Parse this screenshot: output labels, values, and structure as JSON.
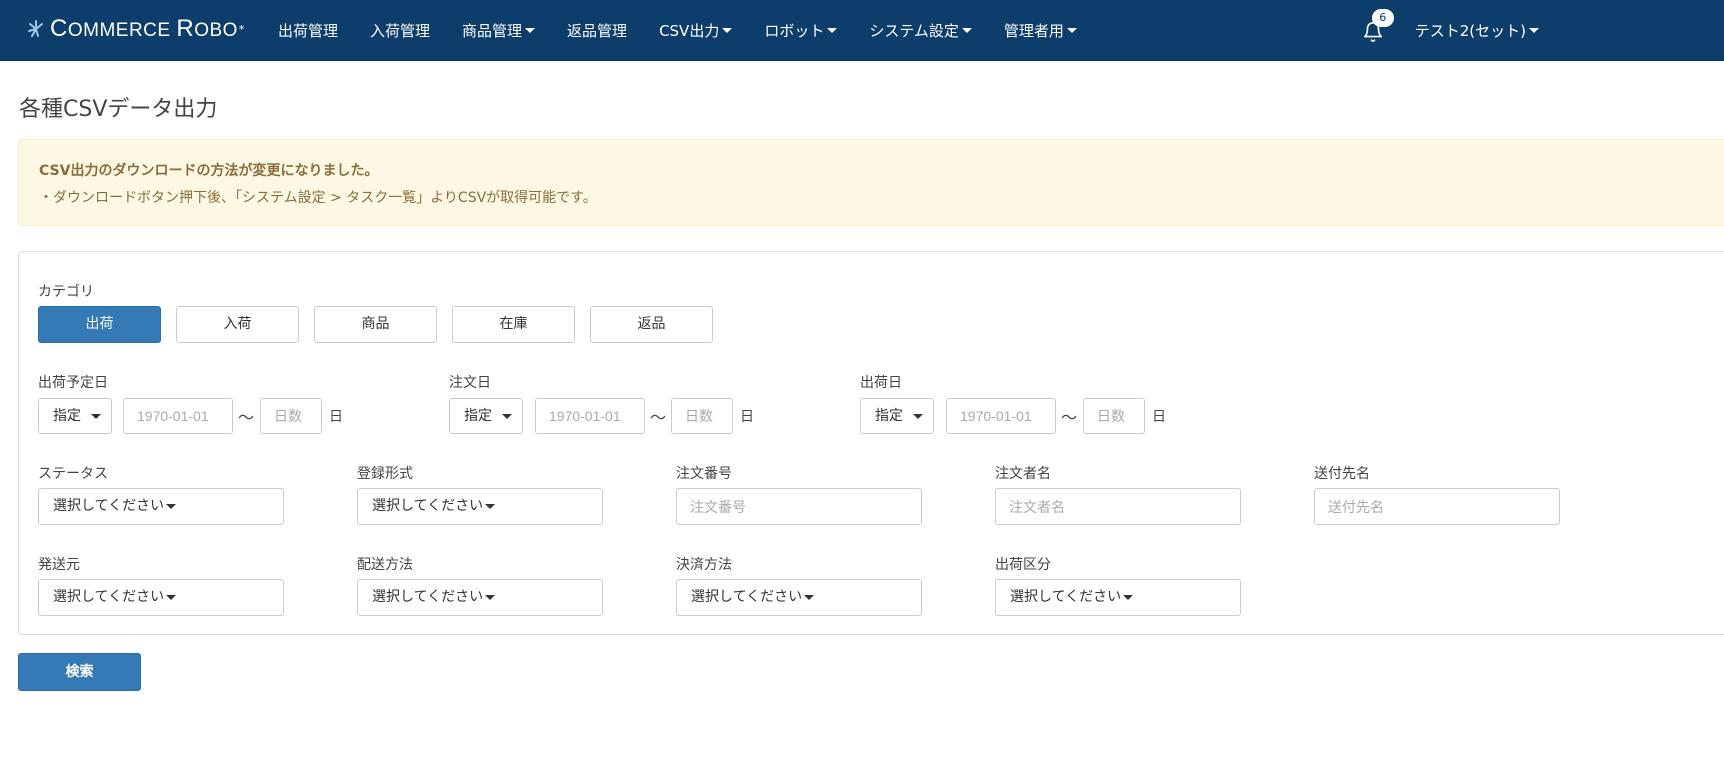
{
  "brand": {
    "name_c": "C",
    "name_ommerce": "OMMERCE ",
    "name_r": "R",
    "name_obo": "OBO",
    "mark": "*"
  },
  "nav": {
    "items": [
      {
        "label": "出荷管理",
        "dropdown": false
      },
      {
        "label": "入荷管理",
        "dropdown": false
      },
      {
        "label": "商品管理",
        "dropdown": true
      },
      {
        "label": "返品管理",
        "dropdown": false
      },
      {
        "label": "CSV出力",
        "dropdown": true
      },
      {
        "label": "ロボット",
        "dropdown": true
      },
      {
        "label": "システム設定",
        "dropdown": true
      },
      {
        "label": "管理者用",
        "dropdown": true
      }
    ],
    "notification_count": "6",
    "user": "テスト2(セット)"
  },
  "page": {
    "title": "各種CSVデータ出力"
  },
  "notice": {
    "title": "CSV出力のダウンロードの方法が変更になりました。",
    "body": "・ダウンロードボタン押下後、「システム設定 > タスク一覧」よりCSVが取得可能です。"
  },
  "category": {
    "label": "カテゴリ",
    "options": [
      "出荷",
      "入荷",
      "商品",
      "在庫",
      "返品"
    ],
    "selected": "出荷"
  },
  "dates": [
    {
      "label": "出荷予定日",
      "mode": "指定",
      "date_placeholder": "1970-01-01",
      "days_placeholder": "日数",
      "tilde": "〜",
      "unit": "日"
    },
    {
      "label": "注文日",
      "mode": "指定",
      "date_placeholder": "1970-01-01",
      "days_placeholder": "日数",
      "tilde": "〜",
      "unit": "日"
    },
    {
      "label": "出荷日",
      "mode": "指定",
      "date_placeholder": "1970-01-01",
      "days_placeholder": "日数",
      "tilde": "〜",
      "unit": "日"
    }
  ],
  "filters": {
    "status": {
      "label": "ステータス",
      "value": "選択してください"
    },
    "registration_type": {
      "label": "登録形式",
      "value": "選択してください"
    },
    "order_number": {
      "label": "注文番号",
      "placeholder": "注文番号"
    },
    "orderer_name": {
      "label": "注文者名",
      "placeholder": "注文者名"
    },
    "recipient_name": {
      "label": "送付先名",
      "placeholder": "送付先名"
    },
    "ship_from": {
      "label": "発送元",
      "value": "選択してください"
    },
    "delivery_method": {
      "label": "配送方法",
      "value": "選択してください"
    },
    "payment_method": {
      "label": "決済方法",
      "value": "選択してください"
    },
    "shipping_category": {
      "label": "出荷区分",
      "value": "選択してください"
    }
  },
  "actions": {
    "search": "検索"
  },
  "colors": {
    "navbar": "#0c3d6b",
    "primary": "#337ab7",
    "notice_bg": "#fcf8e3",
    "notice_text": "#8a6d3b"
  }
}
